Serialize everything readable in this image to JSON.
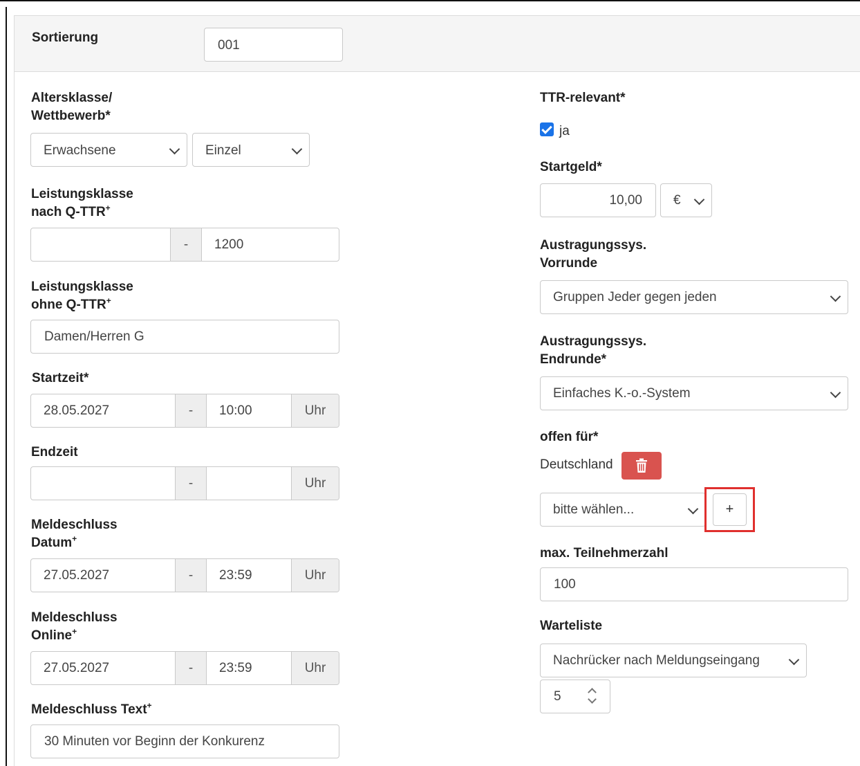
{
  "sortierung": {
    "label": "Sortierung",
    "value": "001"
  },
  "altersklasse": {
    "label_line1": "Altersklasse/",
    "label_line2": "Wettbewerb*",
    "age_value": "Erwachsene",
    "type_value": "Einzel"
  },
  "leistung_qttr": {
    "label_line1": "Leistungsklasse",
    "label_line2": "nach Q-TTR",
    "sup": "+",
    "from_value": "",
    "separator": "-",
    "to_value": "1200"
  },
  "leistung_ohne": {
    "label_line1": "Leistungsklasse",
    "label_line2": "ohne Q-TTR",
    "sup": "+",
    "value": "Damen/Herren G"
  },
  "startzeit": {
    "label": "Startzeit*",
    "date": "28.05.2027",
    "separator": "-",
    "time": "10:00",
    "unit": "Uhr"
  },
  "endzeit": {
    "label": "Endzeit",
    "date": "",
    "separator": "-",
    "time": "",
    "unit": "Uhr"
  },
  "meldeschluss_datum": {
    "label_line1": "Meldeschluss",
    "label_line2": "Datum",
    "sup": "+",
    "date": "27.05.2027",
    "separator": "-",
    "time": "23:59",
    "unit": "Uhr"
  },
  "meldeschluss_online": {
    "label_line1": "Meldeschluss",
    "label_line2": "Online",
    "sup": "+",
    "date": "27.05.2027",
    "separator": "-",
    "time": "23:59",
    "unit": "Uhr"
  },
  "meldeschluss_text": {
    "label": "Meldeschluss Text",
    "sup": "+",
    "value": "30 Minuten vor Beginn der Konkurenz"
  },
  "ttr": {
    "label": "TTR-relevant*",
    "checkbox_label": "ja",
    "checked": true
  },
  "startgeld": {
    "label": "Startgeld*",
    "amount": "10,00",
    "currency": "€"
  },
  "vorrunde": {
    "label_line1": "Austragungssys.",
    "label_line2": "Vorrunde",
    "value": "Gruppen Jeder gegen jeden"
  },
  "endrunde": {
    "label_line1": "Austragungssys.",
    "label_line2": "Endrunde*",
    "value": "Einfaches K.-o.-System"
  },
  "offen_fuer": {
    "label": "offen für*",
    "country": "Deutschland",
    "select_value": "bitte wählen...",
    "add_label": "+"
  },
  "teilnehmer": {
    "label": "max. Teilnehmerzahl",
    "value": "100"
  },
  "warteliste": {
    "label": "Warteliste",
    "mode_value": "Nachrücker nach Meldungseingang",
    "count_value": "5"
  },
  "colors": {
    "danger": "#d9534f",
    "highlight": "#e0302e",
    "checkbox": "#1a73e8",
    "panel_head": "#f5f5f5"
  }
}
